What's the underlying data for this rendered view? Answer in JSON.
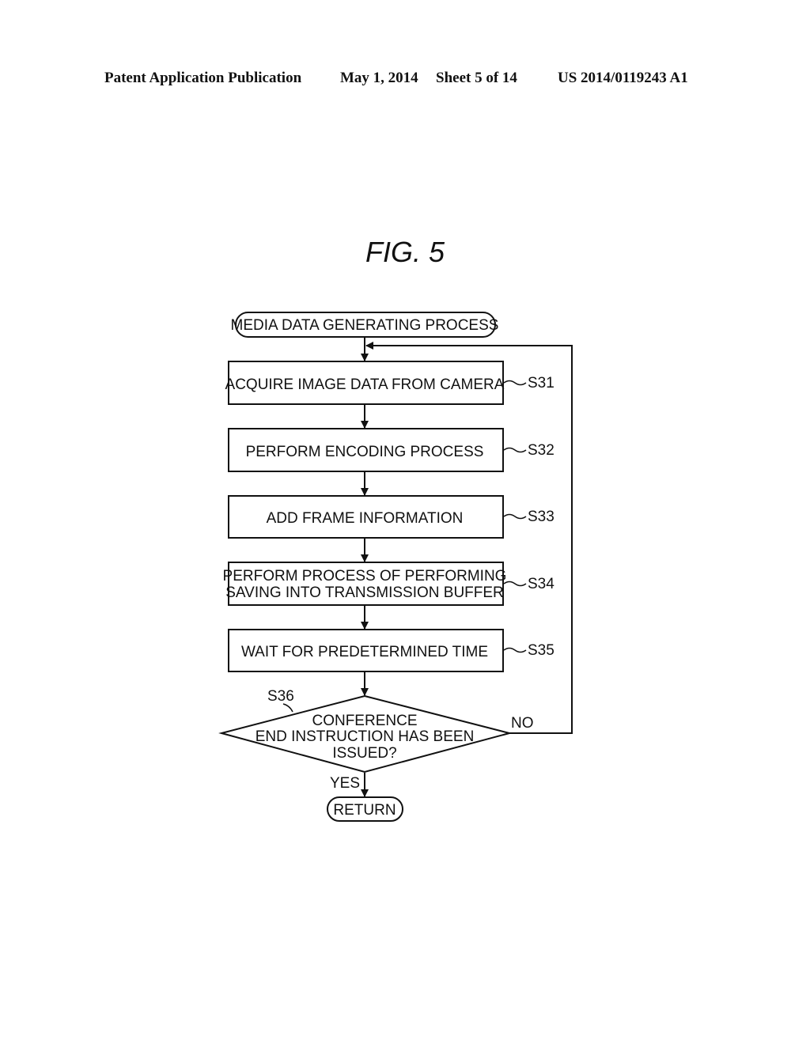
{
  "header": {
    "publication_type": "Patent Application Publication",
    "date": "May 1, 2014",
    "sheet": "Sheet 5 of 14",
    "publication_number": "US 2014/0119243 A1"
  },
  "figure": {
    "title": "FIG. 5",
    "start_terminal": "MEDIA DATA GENERATING PROCESS",
    "steps": [
      {
        "id": "S31",
        "lines": [
          "ACQUIRE IMAGE DATA FROM CAMERA"
        ]
      },
      {
        "id": "S32",
        "lines": [
          "PERFORM ENCODING PROCESS"
        ]
      },
      {
        "id": "S33",
        "lines": [
          "ADD FRAME INFORMATION"
        ]
      },
      {
        "id": "S34",
        "lines": [
          "PERFORM PROCESS OF PERFORMING",
          "SAVING INTO TRANSMISSION BUFFER"
        ]
      },
      {
        "id": "S35",
        "lines": [
          "WAIT FOR PREDETERMINED TIME"
        ]
      }
    ],
    "decision": {
      "id": "S36",
      "lines": [
        "CONFERENCE",
        "END INSTRUCTION HAS BEEN",
        "ISSUED?"
      ],
      "yes_label": "YES",
      "no_label": "NO"
    },
    "end_terminal": "RETURN"
  }
}
